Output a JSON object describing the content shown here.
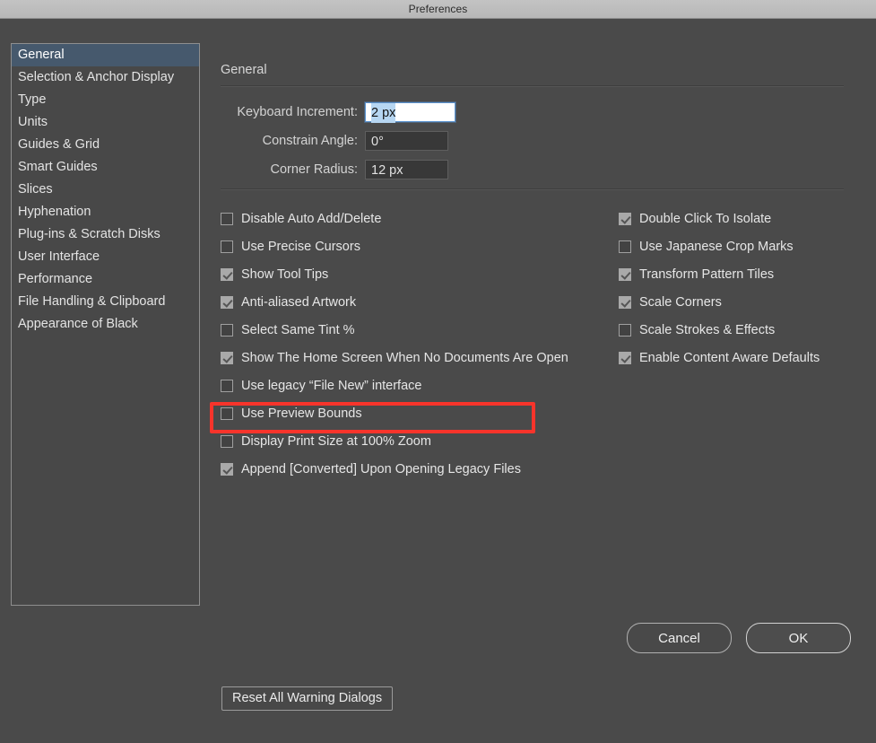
{
  "window": {
    "title": "Preferences"
  },
  "sidebar": {
    "items": [
      {
        "label": "General",
        "selected": true
      },
      {
        "label": "Selection & Anchor Display",
        "selected": false
      },
      {
        "label": "Type",
        "selected": false
      },
      {
        "label": "Units",
        "selected": false
      },
      {
        "label": "Guides & Grid",
        "selected": false
      },
      {
        "label": "Smart Guides",
        "selected": false
      },
      {
        "label": "Slices",
        "selected": false
      },
      {
        "label": "Hyphenation",
        "selected": false
      },
      {
        "label": "Plug-ins & Scratch Disks",
        "selected": false
      },
      {
        "label": "User Interface",
        "selected": false
      },
      {
        "label": "Performance",
        "selected": false
      },
      {
        "label": "File Handling & Clipboard",
        "selected": false
      },
      {
        "label": "Appearance of Black",
        "selected": false
      }
    ]
  },
  "panel": {
    "title": "General",
    "fields": [
      {
        "label": "Keyboard Increment:",
        "value": "2 px",
        "focused": true,
        "selected_text": true
      },
      {
        "label": "Constrain Angle:",
        "value": "0°",
        "focused": false,
        "selected_text": false
      },
      {
        "label": "Corner Radius:",
        "value": "12 px",
        "focused": false,
        "selected_text": false
      }
    ],
    "checkboxes_left": [
      {
        "label": "Disable Auto Add/Delete",
        "checked": false
      },
      {
        "label": "Use Precise Cursors",
        "checked": false
      },
      {
        "label": "Show Tool Tips",
        "checked": true
      },
      {
        "label": "Anti-aliased Artwork",
        "checked": true
      },
      {
        "label": "Select Same Tint %",
        "checked": false
      },
      {
        "label": "Show The Home Screen When No Documents Are Open",
        "checked": true
      },
      {
        "label": "Use legacy “File New” interface",
        "checked": false
      },
      {
        "label": "Use Preview Bounds",
        "checked": false
      },
      {
        "label": "Display Print Size at 100% Zoom",
        "checked": false,
        "highlighted": true
      },
      {
        "label": "Append [Converted] Upon Opening Legacy Files",
        "checked": true
      }
    ],
    "checkboxes_right": [
      {
        "label": "Double Click To Isolate",
        "checked": true
      },
      {
        "label": "Use Japanese Crop Marks",
        "checked": false
      },
      {
        "label": "Transform Pattern Tiles",
        "checked": true
      },
      {
        "label": "Scale Corners",
        "checked": true
      },
      {
        "label": "Scale Strokes & Effects",
        "checked": false
      },
      {
        "label": "Enable Content Aware Defaults",
        "checked": true
      }
    ],
    "reset_button": "Reset All Warning Dialogs"
  },
  "footer": {
    "cancel_label": "Cancel",
    "ok_label": "OK"
  },
  "annotation": {
    "color": "#f8342b",
    "target": "Display Print Size at 100% Zoom"
  }
}
